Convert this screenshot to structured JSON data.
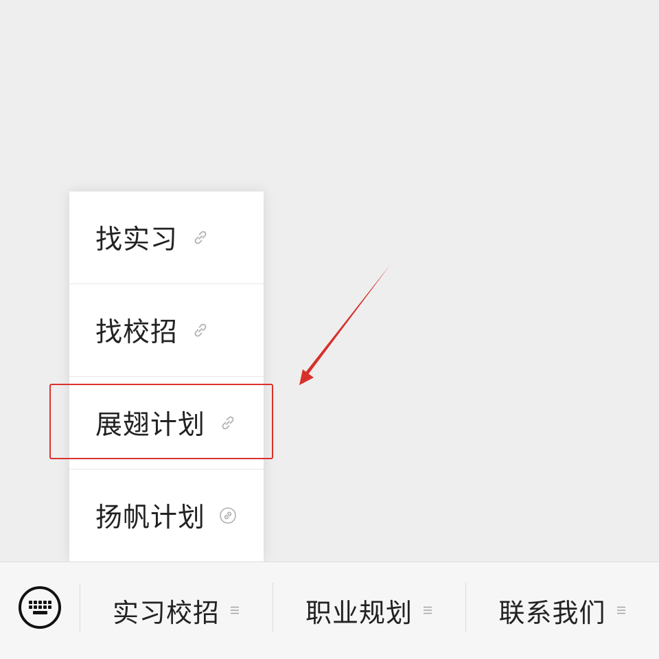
{
  "submenu": {
    "items": [
      {
        "label": "找实习",
        "icon": "link-icon"
      },
      {
        "label": "找校招",
        "icon": "link-icon"
      },
      {
        "label": "展翅计划",
        "icon": "link-icon"
      },
      {
        "label": "扬帆计划",
        "icon": "mini-program-icon"
      }
    ]
  },
  "menubar": {
    "keyboard_icon": "keyboard-icon",
    "tabs": [
      {
        "label": "实习校招",
        "icon": "menu-lines-icon"
      },
      {
        "label": "职业规划",
        "icon": "menu-lines-icon"
      },
      {
        "label": "联系我们",
        "icon": "menu-lines-icon"
      }
    ]
  },
  "annotation": {
    "highlighted_item": "展翅计划",
    "color": "#d8312a"
  },
  "colors": {
    "background": "#efeeef",
    "menu_bg": "#ffffff",
    "menubar_bg": "#f6f6f7",
    "text": "#222222",
    "icon_gray": "#b0b0b0"
  }
}
